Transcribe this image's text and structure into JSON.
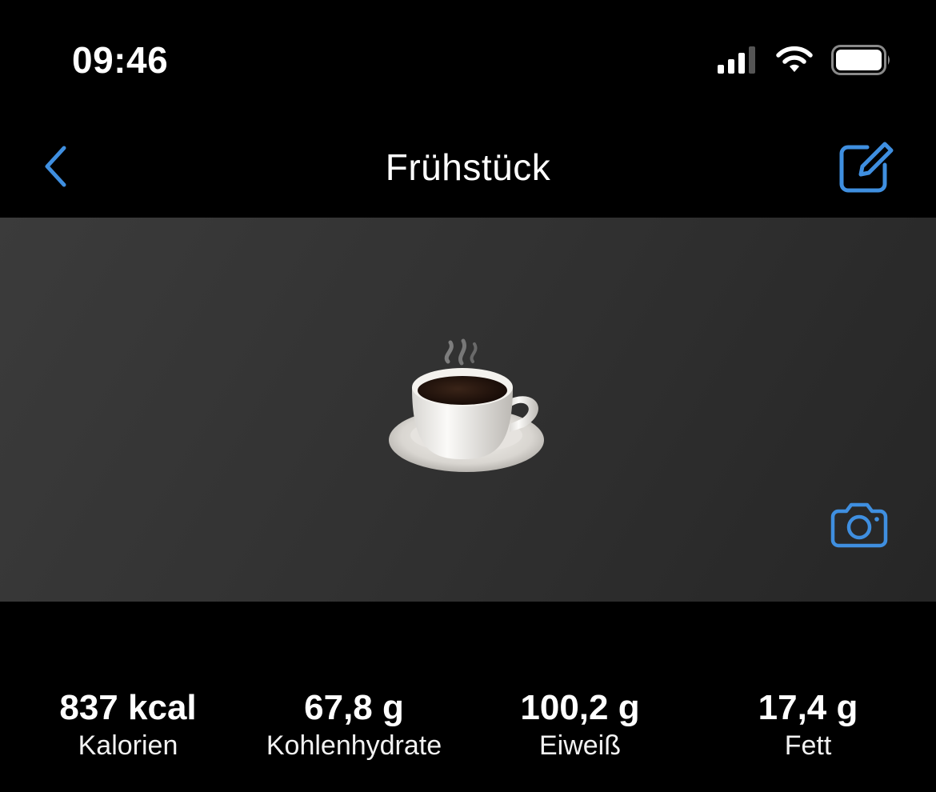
{
  "status_bar": {
    "time": "09:46",
    "icons": [
      "cellular-signal-icon",
      "wifi-icon",
      "battery-icon"
    ]
  },
  "nav": {
    "title": "Frühstück",
    "back_icon": "chevron-left-icon",
    "edit_icon": "edit-square-icon"
  },
  "hero": {
    "image": "coffee-cup-emoji",
    "camera_icon": "camera-icon"
  },
  "stats": [
    {
      "value": "837 kcal",
      "label": "Kalorien"
    },
    {
      "value": "67,8 g",
      "label": "Kohlenhydrate"
    },
    {
      "value": "100,2 g",
      "label": "Eiweiß"
    },
    {
      "value": "17,4 g",
      "label": "Fett"
    }
  ],
  "colors": {
    "accent": "#3f8fe0",
    "background": "#000000",
    "hero_background": "#333333"
  }
}
